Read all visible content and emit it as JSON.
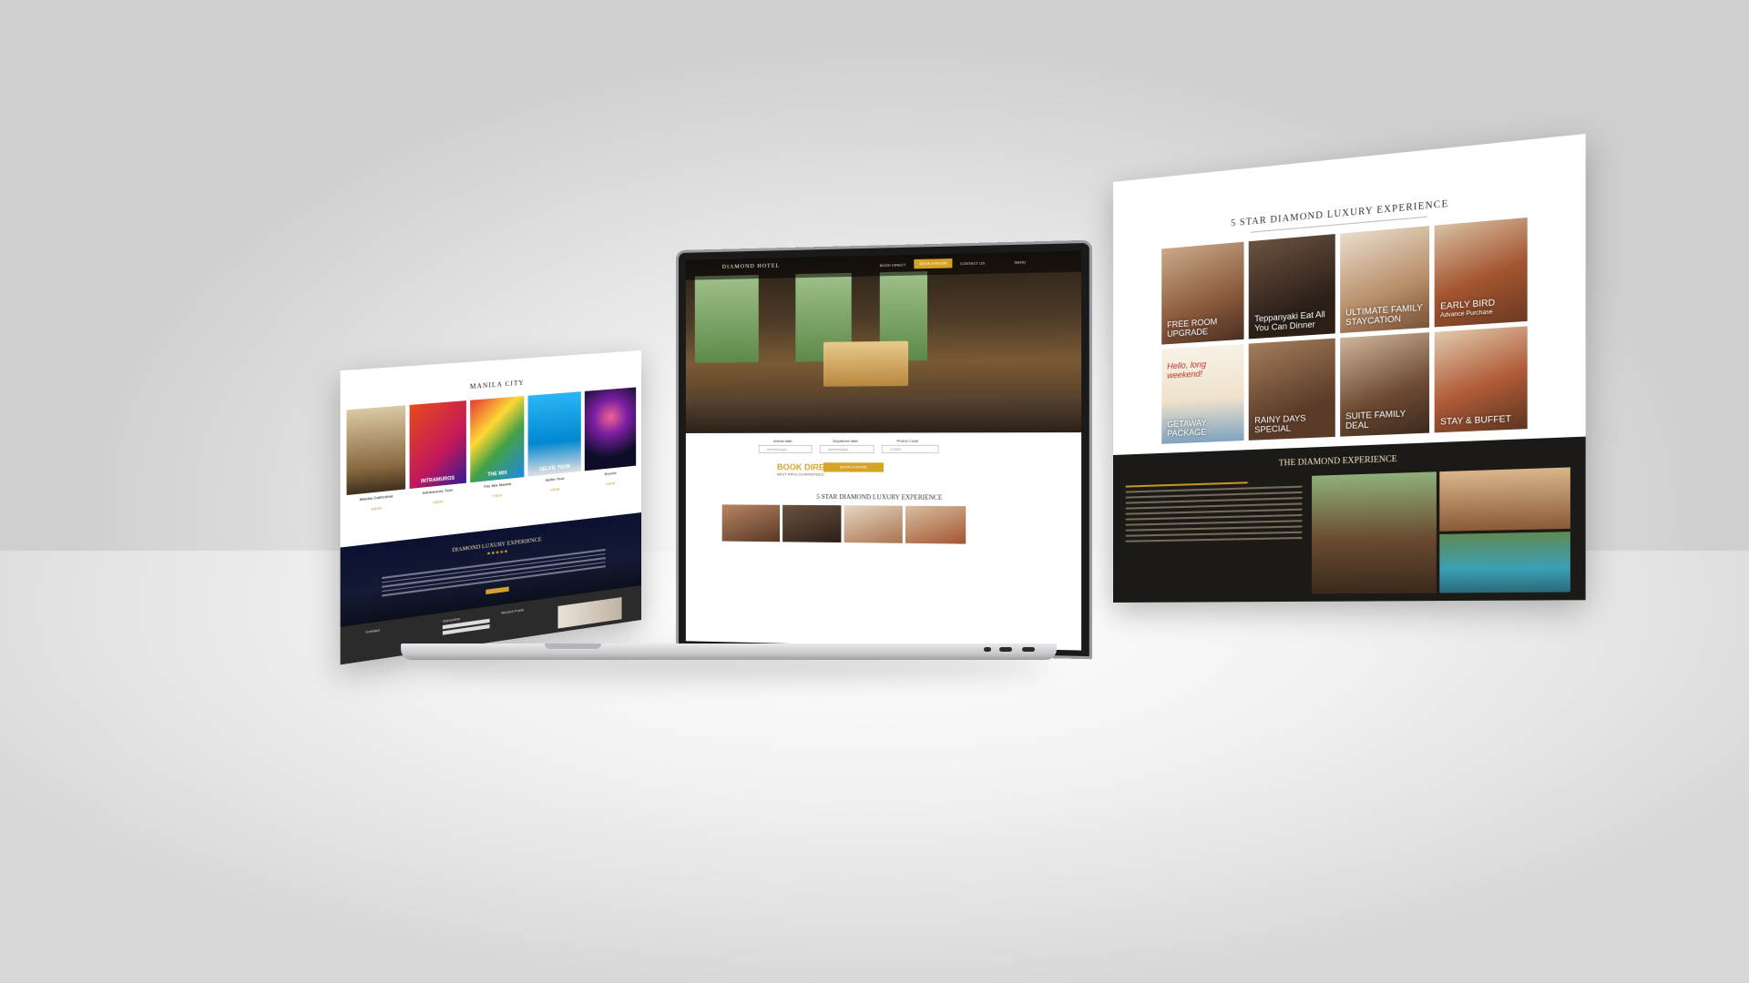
{
  "left_page": {
    "section_title": "MANILA CITY",
    "tiles": [
      {
        "caption": "",
        "label": "Manila Cathedral",
        "link": "VIEW"
      },
      {
        "caption": "INTRAMUROS",
        "label": "Intramuros Tour",
        "link": "VIEW"
      },
      {
        "caption": "THE MIX",
        "label": "The Mix Manila",
        "link": "VIEW"
      },
      {
        "caption": "SELFIE TOUR",
        "label": "Selfie Tour",
        "link": "VIEW"
      },
      {
        "caption": "",
        "label": "Events",
        "link": "VIEW"
      }
    ],
    "dark_title": "DIAMOND LUXURY EXPERIENCE",
    "stars": "★★★★★",
    "footer_cols": [
      "Contact",
      "Subscribe",
      "Recent Posts"
    ]
  },
  "laptop": {
    "logo": "DIAMOND HOTEL",
    "nav_links": [
      "BOOK DIRECT",
      "CONTACT US"
    ],
    "book_button": "BOOK A ROOM",
    "menu": "MENU",
    "form_labels": [
      "Arrival date",
      "Departure date",
      "Promo Code"
    ],
    "fields": [
      "dd/mm/yyyy",
      "dd/mm/yyyy",
      "CODE"
    ],
    "book_direct": "BOOK DIRECT",
    "book_direct_sub": "BEST RATE GUARANTEED",
    "book_now": "BOOK A ROOM",
    "section_title": "5 STAR DIAMOND LUXURY EXPERIENCE"
  },
  "right_page": {
    "section_title": "5 STAR DIAMOND LUXURY EXPERIENCE",
    "cells": [
      {
        "title": "FREE ROOM UPGRADE",
        "sub": ""
      },
      {
        "title": "Teppanyaki Eat All You Can Dinner",
        "sub": ""
      },
      {
        "title": "ULTIMATE FAMILY STAYCATION",
        "sub": ""
      },
      {
        "title": "EARLY BIRD",
        "sub": "Advance Purchase"
      },
      {
        "title": "GETAWAY PACKAGE",
        "sub": "Hello, long weekend!"
      },
      {
        "title": "RAINY DAYS SPECIAL",
        "sub": ""
      },
      {
        "title": "SUITE FAMILY DEAL",
        "sub": ""
      },
      {
        "title": "STAY & BUFFET",
        "sub": ""
      }
    ],
    "experience_title": "THE DIAMOND EXPERIENCE"
  }
}
